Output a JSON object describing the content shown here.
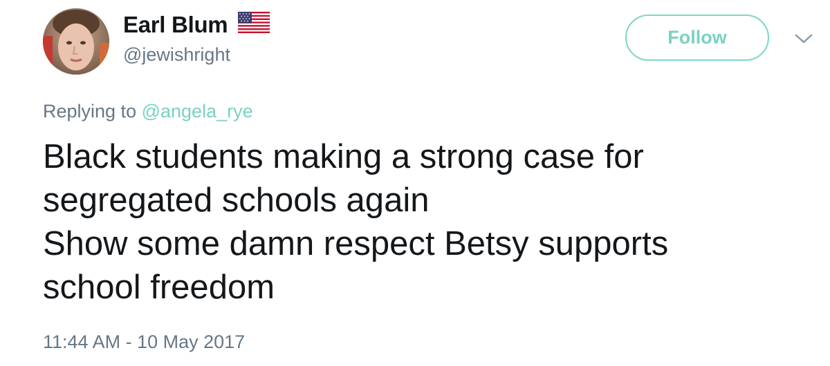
{
  "tweet": {
    "author": {
      "display_name": "Earl Blum",
      "handle": "@jewishright",
      "flag_icon": "us-flag-icon",
      "avatar_icon": "avatar-photo"
    },
    "follow_label": "Follow",
    "menu_icon": "chevron-down-icon",
    "reply": {
      "prefix": "Replying to ",
      "mention": "@angela_rye"
    },
    "text_lines": [
      "Black students making a strong case for",
      "segregated schools again",
      "Show some damn respect Betsy supports",
      "school freedom"
    ],
    "timestamp": "11:44 AM - 10 May 2017"
  },
  "colors": {
    "accent": "#79d2bf",
    "muted": "#657786",
    "text": "#14171a"
  }
}
